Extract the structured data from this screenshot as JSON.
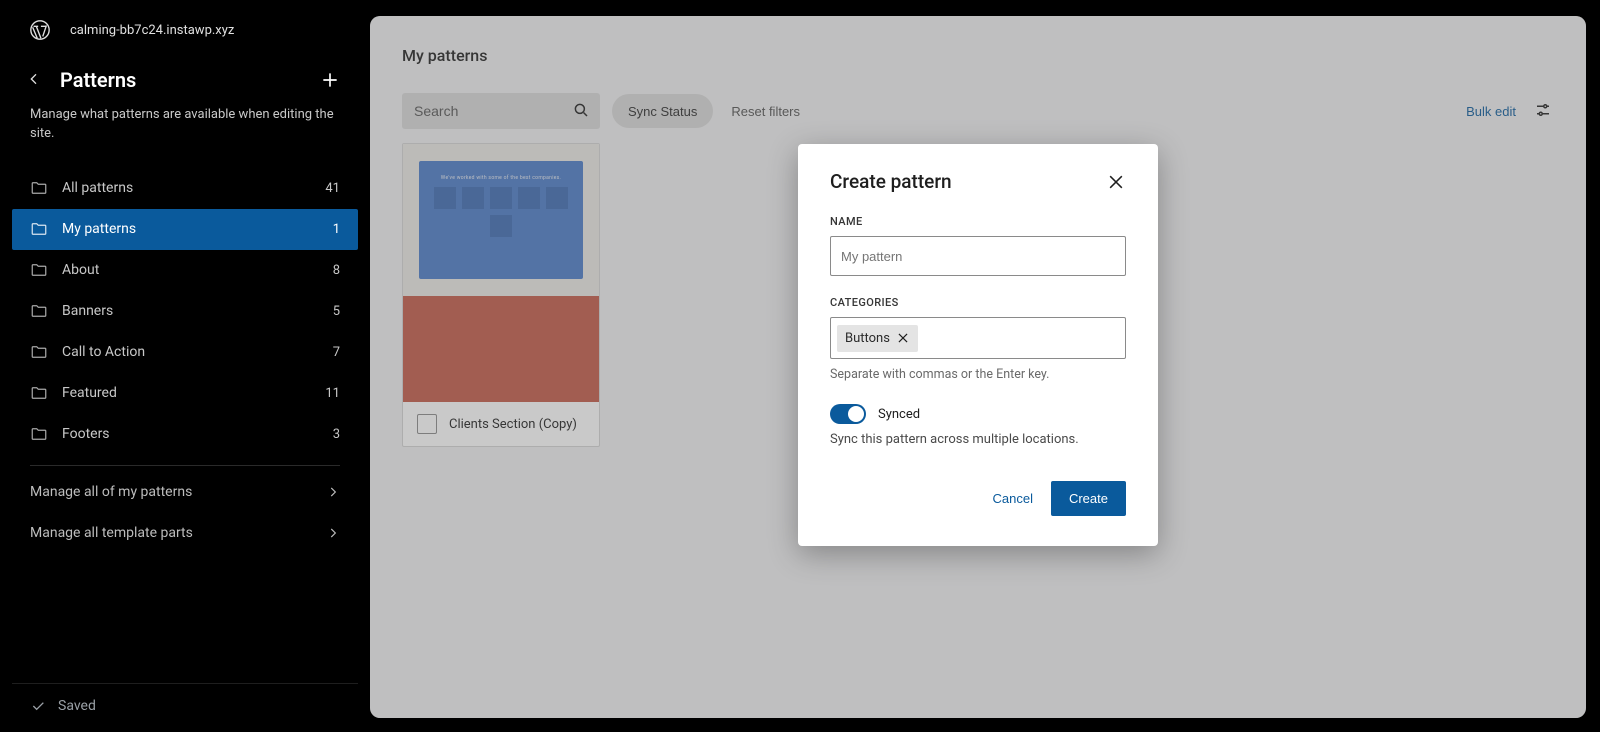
{
  "site_name": "calming-bb7c24.instawp.xyz",
  "sidebar": {
    "title": "Patterns",
    "description": "Manage what patterns are available when editing the site.",
    "items": [
      {
        "label": "All patterns",
        "count": "41"
      },
      {
        "label": "My patterns",
        "count": "1"
      },
      {
        "label": "About",
        "count": "8"
      },
      {
        "label": "Banners",
        "count": "5"
      },
      {
        "label": "Call to Action",
        "count": "7"
      },
      {
        "label": "Featured",
        "count": "11"
      },
      {
        "label": "Footers",
        "count": "3"
      }
    ],
    "manage_my": "Manage all of my patterns",
    "manage_tpl": "Manage all template parts",
    "saved": "Saved"
  },
  "main": {
    "title": "My patterns",
    "search_placeholder": "Search",
    "sync_status": "Sync Status",
    "reset_filters": "Reset filters",
    "bulk_edit": "Bulk edit",
    "card_label": "Clients Section (Copy)",
    "preview_text": "We've worked with some of the best companies."
  },
  "modal": {
    "title": "Create pattern",
    "name_label": "NAME",
    "name_placeholder": "My pattern",
    "categories_label": "CATEGORIES",
    "tag_value": "Buttons",
    "categories_hint": "Separate with commas or the Enter key.",
    "synced_label": "Synced",
    "synced_desc": "Sync this pattern across multiple locations.",
    "cancel": "Cancel",
    "create": "Create"
  }
}
